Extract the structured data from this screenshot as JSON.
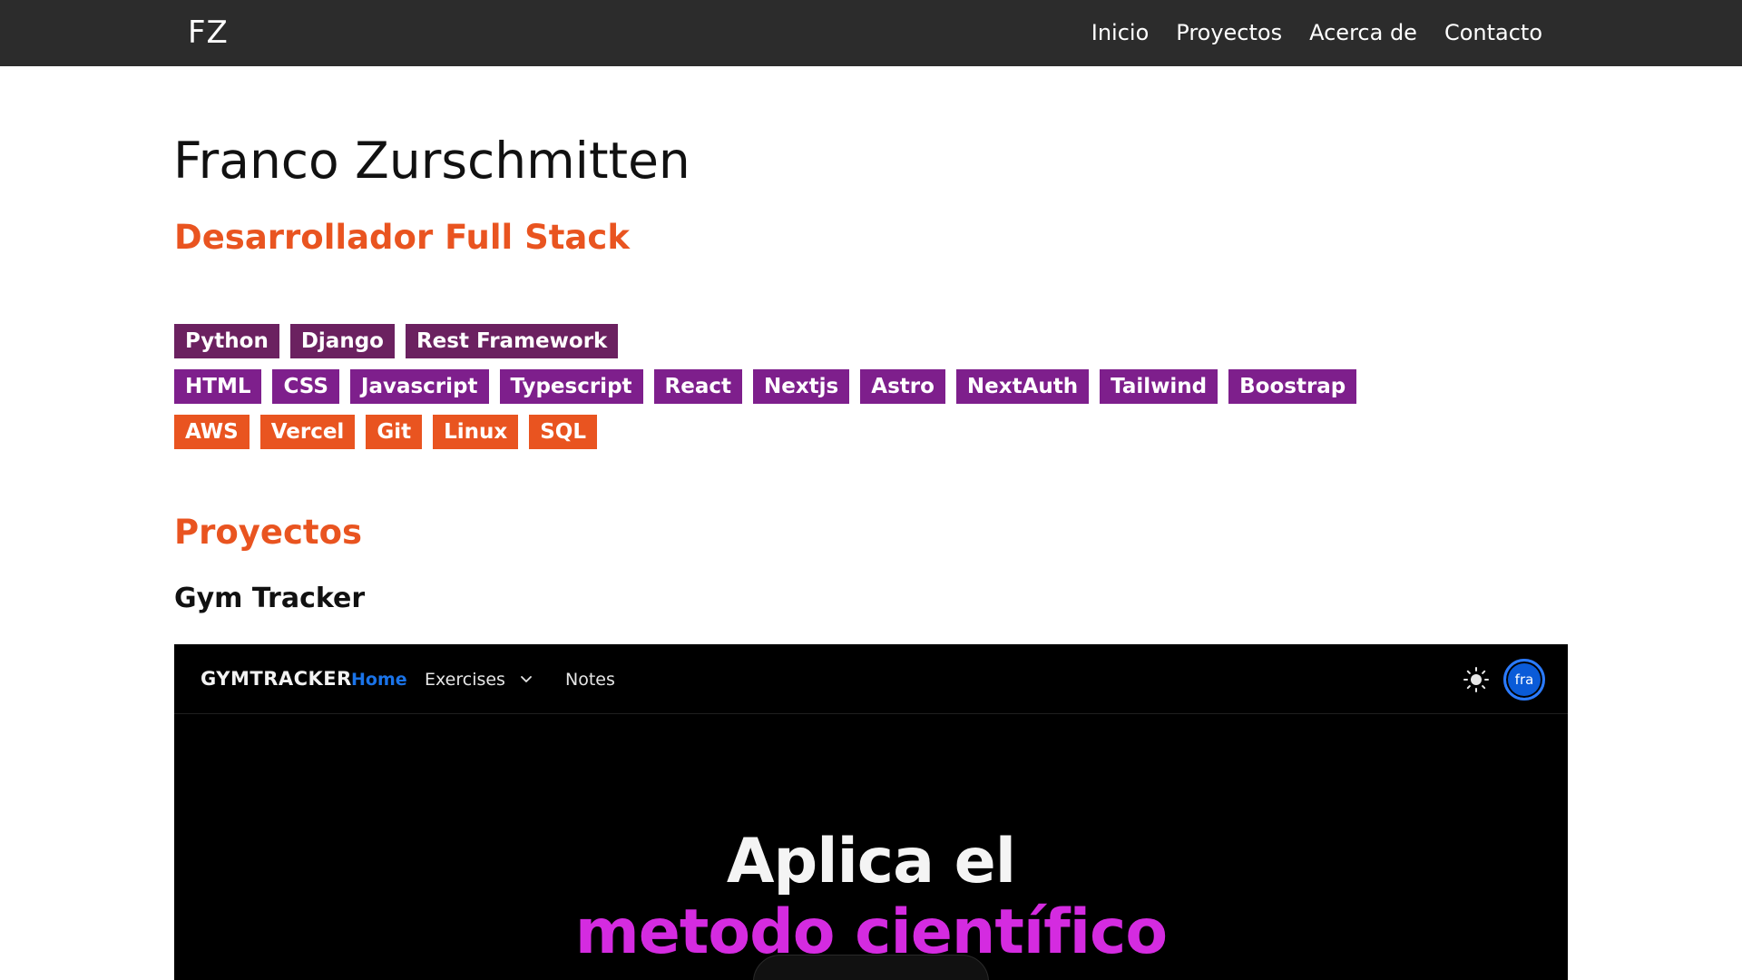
{
  "nav": {
    "brand": "FZ",
    "links": [
      "Inicio",
      "Proyectos",
      "Acerca de",
      "Contacto"
    ]
  },
  "hero": {
    "name": "Franco Zurschmitten",
    "role": "Desarrollador Full Stack"
  },
  "skills": {
    "backend": [
      "Python",
      "Django",
      "Rest Framework"
    ],
    "frontend": [
      "HTML",
      "CSS",
      "Javascript",
      "Typescript",
      "React",
      "Nextjs",
      "Astro",
      "NextAuth",
      "Tailwind",
      "Boostrap"
    ],
    "devops": [
      "AWS",
      "Vercel",
      "Git",
      "Linux",
      "SQL"
    ]
  },
  "projects": {
    "section_title": "Proyectos",
    "items": [
      {
        "title": "Gym Tracker",
        "preview": {
          "brand": "GYMTRACKER",
          "nav_home": "Home",
          "nav_exercises": "Exercises",
          "nav_notes": "Notes",
          "avatar": "fra",
          "headline_line1": "Aplica el",
          "headline_line2": "metodo científico"
        }
      }
    ]
  },
  "colors": {
    "nav_bg": "#2c2c2c",
    "accent_orange": "#e95420",
    "tag_dark": "#6b2160",
    "tag_purple": "#7e1f8c",
    "preview_highlight": "#d42be0",
    "preview_link": "#1a73e8"
  }
}
